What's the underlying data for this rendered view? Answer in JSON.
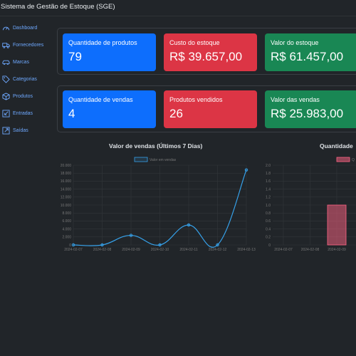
{
  "app": {
    "title": "Sistema de Gestão de Estoque (SGE)"
  },
  "sidebar": {
    "items": [
      {
        "label": "Dashboard",
        "icon": "speedometer-icon"
      },
      {
        "label": "Fornecedores",
        "icon": "truck-icon"
      },
      {
        "label": "Marcas",
        "icon": "car-icon"
      },
      {
        "label": "Categorias",
        "icon": "tag-icon"
      },
      {
        "label": "Produtos",
        "icon": "box-icon"
      },
      {
        "label": "Entradas",
        "icon": "arrow-in-icon"
      },
      {
        "label": "Saídas",
        "icon": "arrow-out-icon"
      }
    ]
  },
  "cards": {
    "row1": [
      {
        "title": "Quantidade de produtos",
        "value": "79",
        "color": "#0d6efd"
      },
      {
        "title": "Custo do estoque",
        "value": "R$ 39.657,00",
        "color": "#dc3545"
      },
      {
        "title": "Valor do estoque",
        "value": "R$ 61.457,00",
        "color": "#198754"
      }
    ],
    "row2": [
      {
        "title": "Quantidade de vendas",
        "value": "4",
        "color": "#0d6efd"
      },
      {
        "title": "Produtos vendidos",
        "value": "26",
        "color": "#dc3545"
      },
      {
        "title": "Valor das vendas",
        "value": "R$ 25.983,00",
        "color": "#198754"
      }
    ]
  },
  "chart_data": [
    {
      "type": "line",
      "title": "Valor de vendas (Últimos 7 Dias)",
      "x": [
        "2024-02-07",
        "2024-02-08",
        "2024-02-09",
        "2024-02-10",
        "2024-02-11",
        "2024-02-12",
        "2024-02-13"
      ],
      "series": [
        {
          "name": "Valor em vendas",
          "values": [
            0,
            0,
            2400,
            0,
            5000,
            0,
            18800
          ],
          "color": "#36a2eb"
        }
      ],
      "yticks": [
        "0",
        "2.000",
        "4.000",
        "6.000",
        "8.000",
        "10.000",
        "12.000",
        "14.000",
        "16.000",
        "18.000",
        "20.000"
      ],
      "ylim": [
        0,
        20000
      ],
      "grid": true,
      "legend": "top"
    },
    {
      "type": "bar",
      "title": "Quantidade",
      "categories": [
        "2024-02-07",
        "2024-02-08",
        "2024-02-09"
      ],
      "series": [
        {
          "name": "Q",
          "values": [
            0,
            0,
            1
          ],
          "color": "#ff6384"
        }
      ],
      "yticks": [
        "0",
        "0.2",
        "0.4",
        "0.6",
        "0.8",
        "1.0",
        "1.2",
        "1.4",
        "1.6",
        "1.8",
        "2.0"
      ],
      "ylim": [
        0,
        2
      ],
      "grid": true,
      "legend": "top"
    }
  ]
}
